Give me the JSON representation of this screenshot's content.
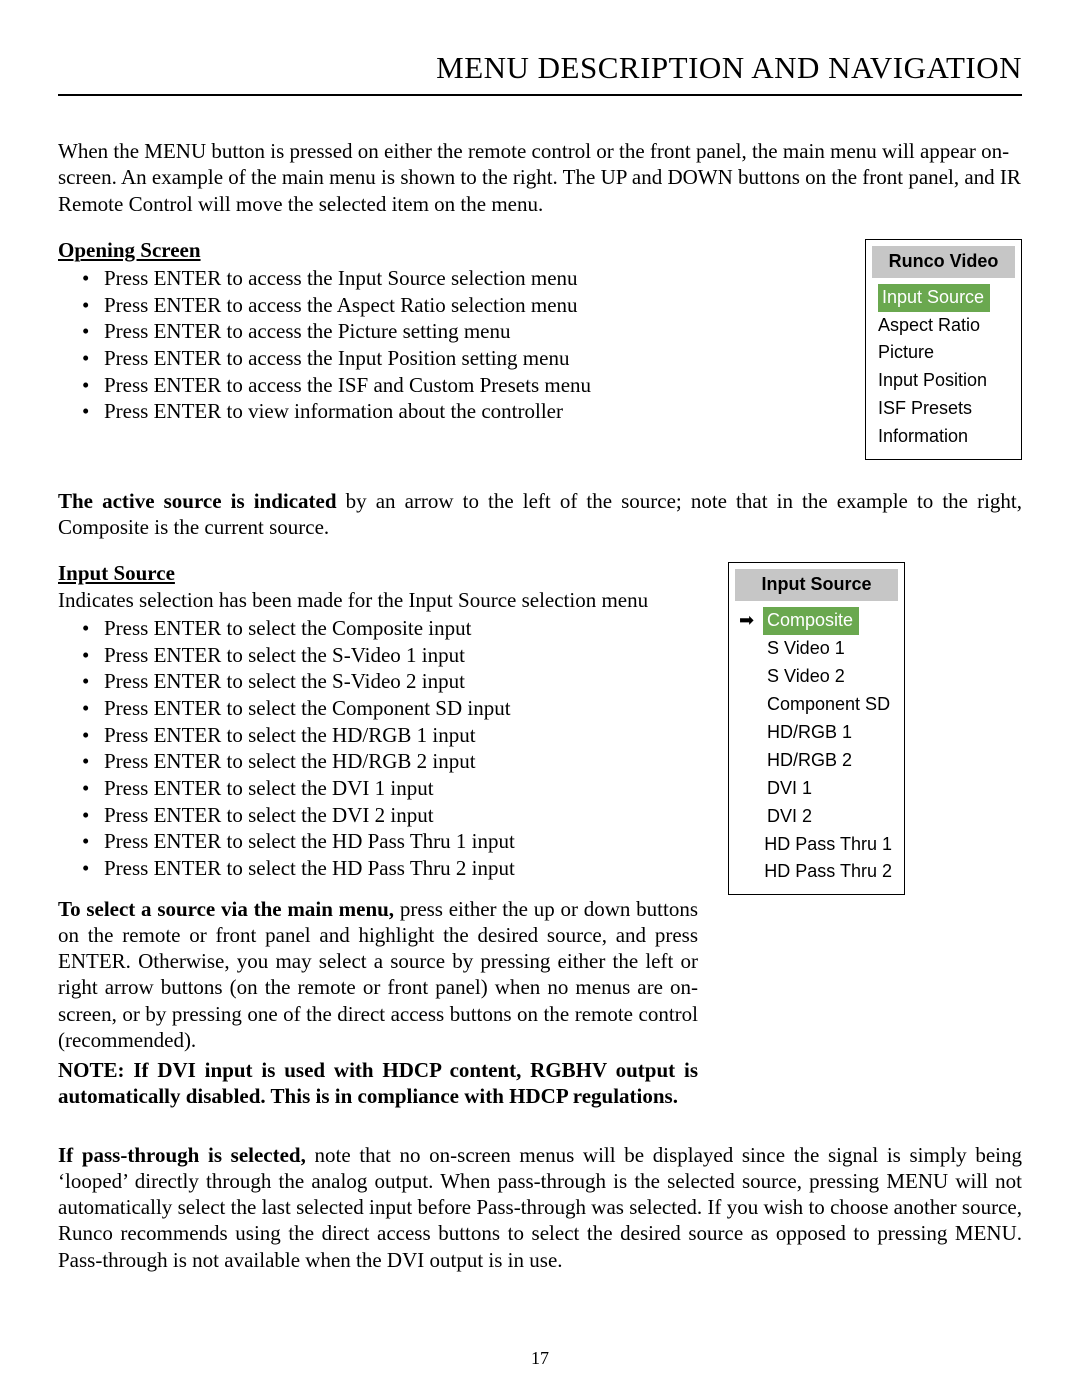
{
  "title": "MENU DESCRIPTION AND NAVIGATION",
  "intro": "When the MENU button is pressed on either the remote control or the front panel, the main menu will appear on-screen. An example of the main menu is shown to the right. The UP and DOWN buttons on the front panel, and IR Remote Control will move the selected item on the menu.",
  "opening_screen": {
    "heading": "Opening Screen",
    "items": [
      "Press ENTER to access the Input Source selection menu",
      "Press ENTER to access the Aspect Ratio selection menu",
      "Press ENTER to access the Picture setting menu",
      "Press ENTER to access the Input Position setting menu",
      "Press ENTER to access the ISF and Custom Presets menu",
      "Press ENTER to view information about the controller"
    ]
  },
  "main_menu": {
    "title": "Runco Video",
    "selected": "Input Source",
    "items": [
      "Aspect Ratio",
      "Picture",
      "Input Position",
      "ISF Presets",
      "Information"
    ]
  },
  "active_source_lead": "The active source is indicated",
  "active_source_rest": " by an arrow to the left of the source; note that in the example to the right, Composite is the current source.",
  "input_source": {
    "heading": "Input Source",
    "subhead": "Indicates selection has been made for the Input Source selection menu",
    "items": [
      "Press ENTER to select the Composite input",
      "Press ENTER to select the S-Video 1 input",
      "Press ENTER to select the S-Video 2 input",
      "Press ENTER to select the Component SD input",
      "Press ENTER to select the HD/RGB 1 input",
      "Press ENTER to select the HD/RGB 2 input",
      "Press ENTER to select the DVI 1 input",
      "Press ENTER to select the DVI 2 input",
      "Press ENTER to select the HD Pass Thru 1 input",
      "Press ENTER to select the HD Pass Thru 2 input"
    ]
  },
  "source_menu": {
    "title": "Input Source",
    "selected": "Composite",
    "items": [
      "S Video 1",
      "S Video 2",
      "Component  SD",
      "HD/RGB 1",
      "HD/RGB 2",
      "DVI 1",
      "DVI 2",
      "HD Pass Thru 1",
      "HD Pass Thru 2"
    ]
  },
  "select_lead": "To select a source via the main menu,",
  "select_rest": " press either the up or down buttons on the remote or front panel and highlight the desired source, and press ENTER. Otherwise, you may select a source by pressing either the left or right arrow buttons (on the remote or front panel) when no menus are on-screen, or by pressing one of the direct access buttons on the remote control (recommended).",
  "note": "NOTE: If DVI input is used with HDCP content, RGBHV output is automatically disabled. This is in compliance with HDCP regulations.",
  "passthrough_lead": "If pass-through is selected,",
  "passthrough_rest": " note that no on-screen menus will be displayed since the signal is simply being ‘looped’ directly through the analog output. When pass-through is the selected source, pressing MENU will not automatically select the last selected input before Pass-through was selected. If you wish to choose another source, Runco recommends using the direct access buttons to select the desired source as opposed to pressing MENU. Pass-through is not available when the DVI output is in use.",
  "page_number": "17"
}
